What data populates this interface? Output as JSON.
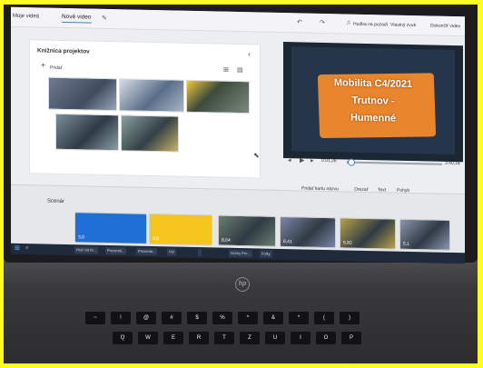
{
  "app": {
    "breadcrumb_prev": "Moje videá",
    "current_tab": "Nové video",
    "toolbar": {
      "background_music": "Hudba na pozadí",
      "custom_audio": "Vlastný zvuk",
      "finish": "Dokončiť video"
    }
  },
  "library": {
    "title": "Knižnica projektov",
    "add_label": "Pridať"
  },
  "preview": {
    "title_lines": [
      "Mobilita C4/2021",
      "Trutnov -",
      "Humenné"
    ],
    "current_time": "0:01,26",
    "total_time": "3:40,18",
    "progress": 0.05
  },
  "storyboard": {
    "label": "Scenár",
    "actions": [
      "Pridať kartu názvu",
      "Orezať",
      "Text",
      "Pohyb"
    ],
    "cards": [
      {
        "duration": "3,0",
        "color": "#1f6fd6"
      },
      {
        "duration": "3,0",
        "color": "#f3c51d"
      },
      {
        "duration": "8,04",
        "color": "#6a7e70"
      },
      {
        "duration": "6,41",
        "color": "#7c86a8"
      },
      {
        "duration": "5,92",
        "color": "#b9a24a"
      },
      {
        "duration": "5,1",
        "color": "#8c97b0"
      }
    ]
  },
  "taskbar": {
    "items": [
      "Hrať vid M...",
      "Prezentá...",
      "Prezentá...",
      "Vid",
      "",
      "Scény Pro...",
      "Fotky"
    ]
  },
  "laptop": {
    "brand": "hp",
    "keys": [
      "~",
      "!",
      "@",
      "#",
      "$",
      "%",
      "^",
      "&",
      "*",
      "(",
      ")",
      "Q",
      "W",
      "E",
      "R",
      "T",
      "Z",
      "U",
      "I",
      "O",
      "P"
    ]
  }
}
